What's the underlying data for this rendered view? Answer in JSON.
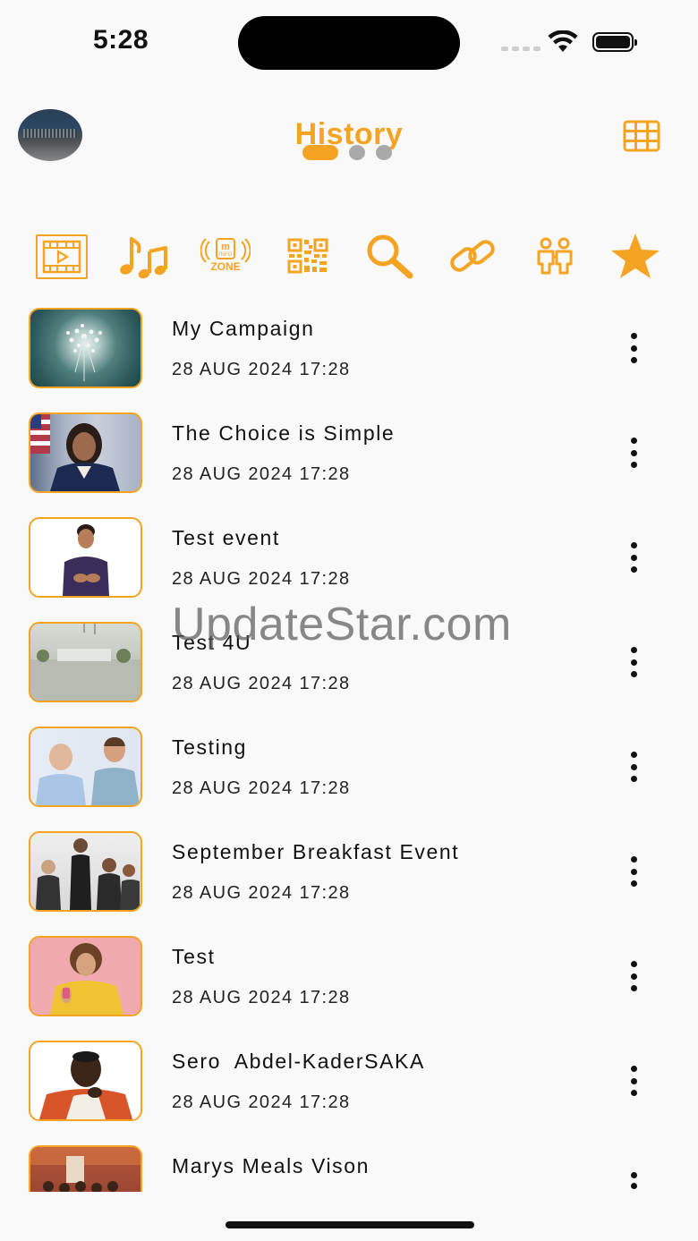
{
  "status_bar": {
    "time": "5:28"
  },
  "header": {
    "title": "History",
    "pager": {
      "pages": 3,
      "active": 0
    }
  },
  "filters": [
    {
      "name": "video-icon",
      "selected": true
    },
    {
      "name": "music-icon",
      "selected": false
    },
    {
      "name": "info-zone-icon",
      "selected": false
    },
    {
      "name": "qr-code-icon",
      "selected": false
    },
    {
      "name": "search-icon",
      "selected": false
    },
    {
      "name": "link-icon",
      "selected": false
    },
    {
      "name": "people-icon",
      "selected": false
    },
    {
      "name": "star-icon",
      "selected": false
    }
  ],
  "info_zone_label": {
    "top": "INFO",
    "bottom": "ZONE"
  },
  "history_items": [
    {
      "title": "My Campaign",
      "date": "28 AUG 2024 17:28"
    },
    {
      "title": "The Choice is Simple",
      "date": "28 AUG 2024 17:28"
    },
    {
      "title": "Test event",
      "date": "28 AUG 2024 17:28"
    },
    {
      "title": "Test 4U",
      "date": "28 AUG 2024 17:28"
    },
    {
      "title": "Testing",
      "date": "28 AUG 2024 17:28"
    },
    {
      "title": "September Breakfast Event",
      "date": "28 AUG 2024 17:28"
    },
    {
      "title": "Test",
      "date": "28 AUG 2024 17:28"
    },
    {
      "title": "Sero  Abdel-KaderSAKA",
      "date": "28 AUG 2024 17:28"
    },
    {
      "title": "Marys Meals Vison",
      "date": ""
    }
  ],
  "watermark": "UpdateStar.com",
  "colors": {
    "accent": "#f5a323",
    "background": "#f9f9f9",
    "text": "#111111"
  }
}
